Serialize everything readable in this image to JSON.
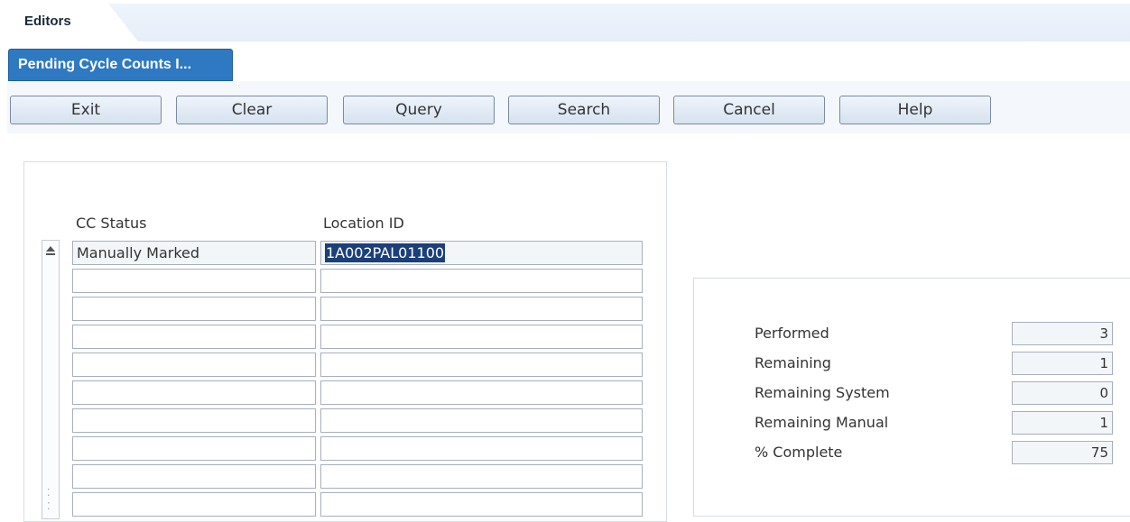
{
  "editors_tab": {
    "label": "Editors"
  },
  "form_tab": {
    "label": "Pending Cycle Counts I..."
  },
  "toolbar": {
    "exit": "Exit",
    "clear": "Clear",
    "query": "Query",
    "search": "Search",
    "cancel": "Cancel",
    "help": "Help"
  },
  "grid": {
    "columns": {
      "status": "CC Status",
      "location": "Location ID"
    },
    "rows": [
      {
        "status": "Manually Marked",
        "location": "1A002PAL01100"
      },
      {
        "status": "",
        "location": ""
      },
      {
        "status": "",
        "location": ""
      },
      {
        "status": "",
        "location": ""
      },
      {
        "status": "",
        "location": ""
      },
      {
        "status": "",
        "location": ""
      },
      {
        "status": "",
        "location": ""
      },
      {
        "status": "",
        "location": ""
      },
      {
        "status": "",
        "location": ""
      },
      {
        "status": "",
        "location": ""
      }
    ]
  },
  "stats": {
    "performed_label": "Performed",
    "performed": "3",
    "remaining_label": "Remaining",
    "remaining": "1",
    "remaining_system_label": "Remaining System",
    "remaining_system": "0",
    "remaining_manual_label": "Remaining Manual",
    "remaining_manual": "1",
    "complete_label": "% Complete",
    "complete": "75"
  },
  "colors": {
    "accent": "#2e79c2",
    "selection": "#1b3f7a"
  }
}
